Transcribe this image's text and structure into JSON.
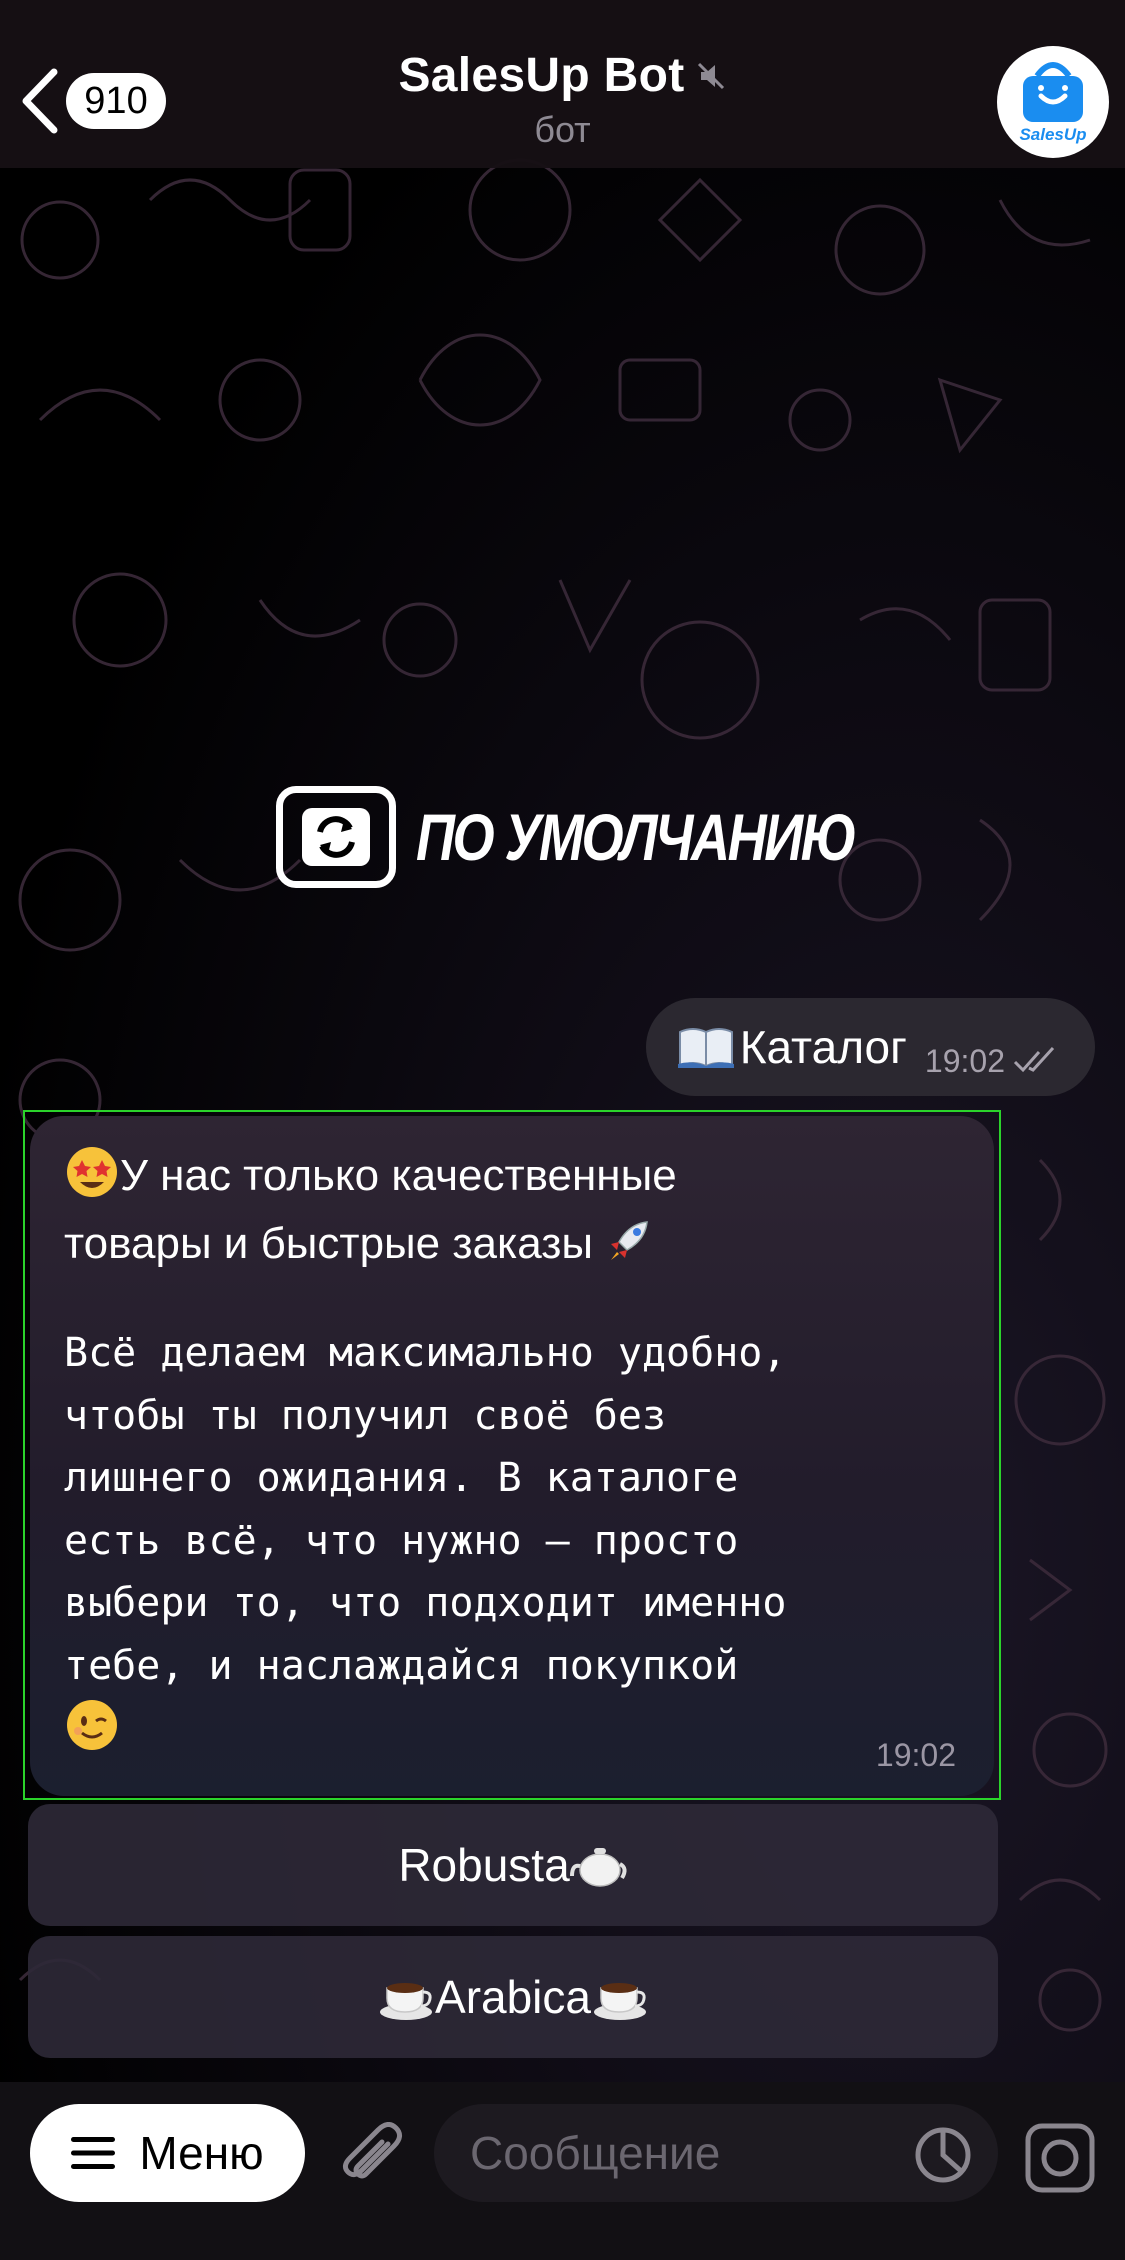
{
  "header": {
    "back_badge": "910",
    "title": "SalesUp Bot",
    "subtitle": "бот",
    "avatar_text": "SalesUp"
  },
  "overlay": {
    "text": "ПО УМОЛЧАНИЮ"
  },
  "messages": {
    "outgoing": {
      "text": "Каталог",
      "time": "19:02"
    },
    "incoming": {
      "head_line1": "У нас только качественные",
      "head_line2": "товары и быстрые заказы",
      "body": " Всё делаем максимально удобно,\nчтобы ты получил своё без\nлишнего ожидания. В каталоге\nесть всё, что нужно — просто\nвыбери то, что подходит именно\nтебе, и наслаждайся покупкой",
      "time": "19:02"
    }
  },
  "keyboard": {
    "buttons": [
      {
        "label": "Robusta"
      },
      {
        "label": "Arabica"
      }
    ]
  },
  "composer": {
    "menu_label": "Меню",
    "placeholder": "Сообщение"
  },
  "colors": {
    "highlight": "#2bd32b",
    "avatar_blue": "#1a8df0"
  },
  "icons": [
    "back-chevron-icon",
    "mute-icon",
    "book-icon",
    "double-check-icon",
    "star-struck-emoji-icon",
    "rocket-emoji-icon",
    "wink-emoji-icon",
    "teapot-icon",
    "coffee-cup-icon",
    "menu-icon",
    "attach-icon",
    "sticker-icon",
    "camera-icon"
  ]
}
